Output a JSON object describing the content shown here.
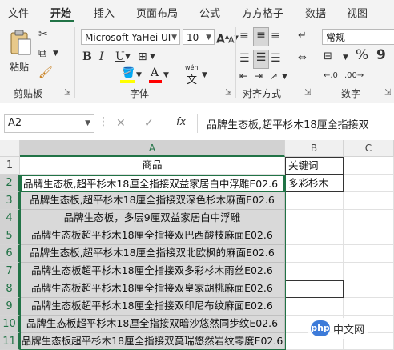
{
  "tabs": [
    "文件",
    "开始",
    "插入",
    "页面布局",
    "公式",
    "方方格子",
    "数据",
    "视图"
  ],
  "active_tab": "开始",
  "clipboard": {
    "paste_label": "粘贴",
    "group_label": "剪贴板"
  },
  "font": {
    "name": "Microsoft YaHei UI",
    "size": "10",
    "group_label": "字体",
    "bold": "B",
    "italic": "I",
    "underline": "U",
    "grow": "A",
    "shrink": "A",
    "fill_color": "#ffff00",
    "font_color": "#ff0000",
    "phonetic": "wén",
    "phonetic_char": "文"
  },
  "alignment": {
    "group_label": "对齐方式"
  },
  "number": {
    "format": "常规",
    "group_label": "数字",
    "percent": "%",
    "comma": "9"
  },
  "formula_bar": {
    "name_box": "A2",
    "fx": "fx",
    "content": "品牌生态板,超平杉木18厘全指接双"
  },
  "columns": [
    "A",
    "B",
    "C"
  ],
  "rows": [
    {
      "num": "1",
      "a": "商品",
      "b": "关键词",
      "gray": false
    },
    {
      "num": "2",
      "a": "品牌生态板,超平杉木18厘全指接双益家居白中浮雕E02.6",
      "b": "多彩杉木",
      "gray": false
    },
    {
      "num": "3",
      "a": "品牌生态板,超平杉木18厘全指接双深色杉木麻面E02.6",
      "b": "",
      "gray": true
    },
    {
      "num": "4",
      "a": "品牌生态板，多层9厘双益家居白中浮雕",
      "b": "",
      "gray": true
    },
    {
      "num": "5",
      "a": "品牌生态板超平杉木18厘全指接双巴西酸枝麻面E02.6",
      "b": "",
      "gray": true
    },
    {
      "num": "6",
      "a": "品牌生态板,超平杉木18厘全指接双北欧枫的麻面E02.6",
      "b": "",
      "gray": true
    },
    {
      "num": "7",
      "a": "品牌生态板超平杉木18厘全指接双多彩杉木雨丝E02.6",
      "b": "",
      "gray": true
    },
    {
      "num": "8",
      "a": "品牌生态板超平杉木18厘全指接双皇家胡桃麻面E02.6",
      "b": "",
      "gray": true
    },
    {
      "num": "9",
      "a": "品牌生态板超平杉木18厘全指接双印尼布纹麻面E02.6",
      "b": "",
      "gray": true
    },
    {
      "num": "10",
      "a": "品牌生态板超平杉木18厘全指接双暗沙悠然同步纹E02.6",
      "b": "",
      "gray": true
    },
    {
      "num": "11",
      "a": "品牌生态板超平杉木18厘全指接双莫瑞悠然岩纹零度E02.6",
      "b": "",
      "gray": true
    }
  ],
  "watermark": {
    "logo": "php",
    "text": "中文网"
  },
  "colors": {
    "accent": "#217346",
    "selection_fill": "#d9d9d9"
  }
}
